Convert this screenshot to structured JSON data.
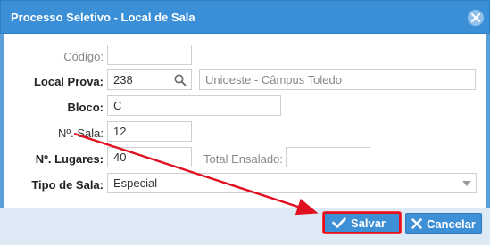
{
  "dialog": {
    "title": "Processo Seletivo - Local de Sala"
  },
  "form": {
    "codigo": {
      "label": "Código:",
      "value": ""
    },
    "local_prova": {
      "label": "Local Prova:",
      "code": "238",
      "name": "Unioeste - Câmpus Toledo"
    },
    "bloco": {
      "label": "Bloco:",
      "value": "C"
    },
    "numero_sala": {
      "label": "Nº. Sala:",
      "value": "12"
    },
    "numero_lugares": {
      "label": "Nº. Lugares:",
      "value": "40"
    },
    "total_ensalado": {
      "label": "Total Ensalado:",
      "value": ""
    },
    "tipo_sala": {
      "label": "Tipo de Sala:",
      "value": "Especial"
    }
  },
  "footer": {
    "save_label": "Salvar",
    "cancel_label": "Cancelar"
  },
  "colors": {
    "titlebar": "#3a8fd6",
    "button": "#3d8fd6",
    "highlight": "#e01020",
    "footer": "#dde9f4"
  },
  "icons": [
    "close-icon",
    "search-icon",
    "chevron-down-icon",
    "check-icon",
    "x-icon"
  ]
}
